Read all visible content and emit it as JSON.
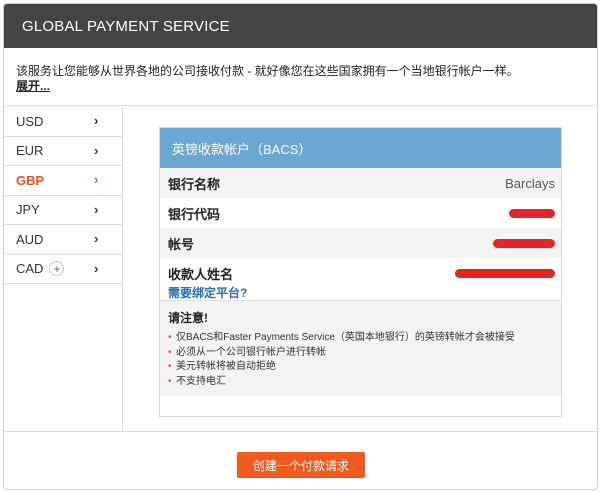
{
  "header": {
    "title": "GLOBAL PAYMENT SERVICE"
  },
  "intro": {
    "text": "该服务让您能够从世界各地的公司接收付款 - 就好像您在这些国家拥有一个当地银行帐户一样。",
    "expand_label": "展开..."
  },
  "currencies": [
    {
      "code": "USD",
      "active": false
    },
    {
      "code": "EUR",
      "active": false
    },
    {
      "code": "GBP",
      "active": true
    },
    {
      "code": "JPY",
      "active": false
    },
    {
      "code": "AUD",
      "active": false
    },
    {
      "code": "CAD",
      "active": false,
      "add_symbol": "+"
    }
  ],
  "chevron_symbol": "›",
  "account_panel": {
    "title": "英镑收款帐户（BACS）",
    "bank_name_label": "银行名称",
    "bank_name_value": "Barclays",
    "bank_code_label": "银行代码",
    "account_number_label": "帐号",
    "payee_name_label": "收款人姓名",
    "bind_platform_link": "需要绑定平台?",
    "redaction_color": "#e8202a"
  },
  "notice": {
    "title": "请注意!",
    "items": [
      "仅BACS和Faster Payments Service（英国本地银行）的英镑转帐才会被接受",
      "必须从一个公司银行帐户进行转帐",
      "美元转帐将被自动拒绝",
      "不支持电汇"
    ]
  },
  "footer": {
    "create_button_label": "创建一个付款请求"
  },
  "colors": {
    "header_bg": "#444444",
    "accent": "#f15a1c",
    "panel_head": "#6aa7d3",
    "link": "#2a6fb3"
  }
}
